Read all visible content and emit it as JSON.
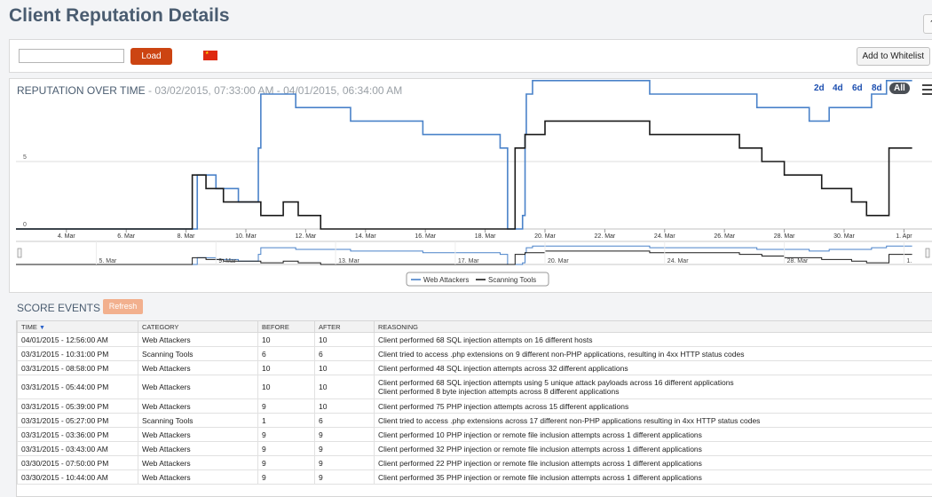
{
  "page": {
    "title": "Client Reputation Details",
    "corner_button": "?"
  },
  "toolbar": {
    "ip_value": "",
    "load_label": "Load",
    "flag_text": "★",
    "whitelist_label": "Add to Whitelist"
  },
  "chart_header": {
    "title": "REPUTATION OVER TIME",
    "range": " - 03/02/2015, 07:33:00 AM - 04/01/2015, 06:34:00 AM",
    "ranges": [
      "2d",
      "4d",
      "6d",
      "8d",
      "All"
    ],
    "selected_range": "All"
  },
  "chart_data": {
    "type": "line",
    "x_start": "2015-03-02 07:33",
    "x_end": "2015-04-01 06:34",
    "xticks": [
      "4. Mar",
      "6. Mar",
      "8. Mar",
      "10. Mar",
      "12. Mar",
      "14. Mar",
      "16. Mar",
      "18. Mar",
      "20. Mar",
      "22. Mar",
      "24. Mar",
      "26. Mar",
      "28. Mar",
      "30. Mar",
      "1. Apr"
    ],
    "yticks": [
      0,
      5
    ],
    "ylim": [
      0,
      10.5
    ],
    "step": true,
    "grid": true,
    "legend_position": "bottom-center",
    "series": [
      {
        "name": "Web Attackers",
        "color": "#4a82c9",
        "points": [
          [
            "2015-03-02 07:33",
            0
          ],
          [
            "2015-03-08 09:00",
            0
          ],
          [
            "2015-03-08 09:00",
            4
          ],
          [
            "2015-03-09 00:00",
            3
          ],
          [
            "2015-03-09 18:00",
            2
          ],
          [
            "2015-03-10 10:00",
            6
          ],
          [
            "2015-03-10 12:00",
            10
          ],
          [
            "2015-03-11 00:00",
            10
          ],
          [
            "2015-03-11 16:00",
            9
          ],
          [
            "2015-03-13 12:00",
            8
          ],
          [
            "2015-03-15 22:00",
            7
          ],
          [
            "2015-03-18 12:00",
            6
          ],
          [
            "2015-03-18 18:00",
            0
          ],
          [
            "2015-03-19 06:00",
            0
          ],
          [
            "2015-03-19 06:00",
            1
          ],
          [
            "2015-03-19 08:00",
            7
          ],
          [
            "2015-03-19 09:00",
            10
          ],
          [
            "2015-03-19 14:00",
            11
          ],
          [
            "2015-03-23 12:00",
            10
          ],
          [
            "2015-03-27 02:00",
            9
          ],
          [
            "2015-03-28 20:00",
            8
          ],
          [
            "2015-03-29 12:00",
            9
          ],
          [
            "2015-03-30 22:00",
            10
          ],
          [
            "2015-03-31 10:00",
            11
          ],
          [
            "2015-04-01 06:34",
            11
          ]
        ]
      },
      {
        "name": "Scanning Tools",
        "color": "#1a1a1a",
        "points": [
          [
            "2015-03-02 07:33",
            0
          ],
          [
            "2015-03-08 05:00",
            0
          ],
          [
            "2015-03-08 05:00",
            4
          ],
          [
            "2015-03-08 16:00",
            3
          ],
          [
            "2015-03-09 06:00",
            2
          ],
          [
            "2015-03-10 12:00",
            1
          ],
          [
            "2015-03-11 06:00",
            2
          ],
          [
            "2015-03-11 18:00",
            1
          ],
          [
            "2015-03-12 12:00",
            0
          ],
          [
            "2015-03-19 00:00",
            0
          ],
          [
            "2015-03-19 00:00",
            6
          ],
          [
            "2015-03-19 08:00",
            7
          ],
          [
            "2015-03-20 00:00",
            8
          ],
          [
            "2015-03-22 18:00",
            8
          ],
          [
            "2015-03-23 12:00",
            7
          ],
          [
            "2015-03-26 12:00",
            6
          ],
          [
            "2015-03-27 06:00",
            5
          ],
          [
            "2015-03-28 00:00",
            4
          ],
          [
            "2015-03-29 06:00",
            3
          ],
          [
            "2015-03-30 06:00",
            2
          ],
          [
            "2015-03-30 18:00",
            1
          ],
          [
            "2015-03-31 12:00",
            6
          ],
          [
            "2015-04-01 06:34",
            6
          ]
        ]
      }
    ],
    "navigator_xticks": [
      "5. Mar",
      "9. Mar",
      "13. Mar",
      "17. Mar",
      "20. Mar",
      "24. Mar",
      "28. Mar",
      "1."
    ]
  },
  "score_events": {
    "title": "SCORE EVENTS",
    "refresh_label": "Refresh",
    "columns": [
      "TIME",
      "CATEGORY",
      "BEFORE",
      "AFTER",
      "REASONING"
    ],
    "sort_indicator": "▼",
    "rows": [
      [
        "04/01/2015 - 12:56:00 AM",
        "Web Attackers",
        "10",
        "10",
        "Client performed 68 SQL injection attempts on 16 different hosts"
      ],
      [
        "03/31/2015 - 10:31:00 PM",
        "Scanning Tools",
        "6",
        "6",
        "Client tried to access .php extensions on 9 different non-PHP applications, resulting in 4xx HTTP status codes"
      ],
      [
        "03/31/2015 - 08:58:00 PM",
        "Web Attackers",
        "10",
        "10",
        "Client performed 48 SQL injection attempts across 32 different applications"
      ],
      [
        "03/31/2015 - 05:44:00 PM",
        "Web Attackers",
        "10",
        "10",
        "Client performed 68 SQL injection attempts using 5 unique attack payloads across 16 different applications",
        "Client performed 8 byte injection attempts across 8 different applications"
      ],
      [
        "03/31/2015 - 05:39:00 PM",
        "Web Attackers",
        "9",
        "10",
        "Client performed 75 PHP injection attempts across 15 different applications"
      ],
      [
        "03/31/2015 - 05:27:00 PM",
        "Scanning Tools",
        "1",
        "6",
        "Client tried to access .php extensions across 17 different non-PHP applications resulting in 4xx HTTP status codes"
      ],
      [
        "03/31/2015 - 03:36:00 PM",
        "Web Attackers",
        "9",
        "9",
        "Client performed 10 PHP injection or remote file inclusion attempts across 1 different applications"
      ],
      [
        "03/31/2015 - 03:43:00 AM",
        "Web Attackers",
        "9",
        "9",
        "Client performed 32 PHP injection or remote file inclusion attempts across 1 different applications"
      ],
      [
        "03/30/2015 - 07:50:00 PM",
        "Web Attackers",
        "9",
        "9",
        "Client performed 22 PHP injection or remote file inclusion attempts across 1 different applications"
      ],
      [
        "03/30/2015 - 10:44:00 AM",
        "Web Attackers",
        "9",
        "9",
        "Client performed 35 PHP injection or remote file inclusion attempts across 1 different applications"
      ]
    ]
  }
}
